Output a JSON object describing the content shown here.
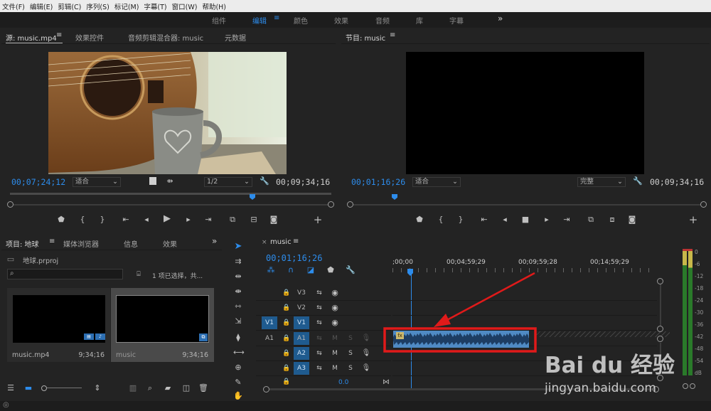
{
  "menu": [
    "文件(F)",
    "编辑(E)",
    "剪辑(C)",
    "序列(S)",
    "标记(M)",
    "字幕(T)",
    "窗口(W)",
    "帮助(H)"
  ],
  "workspaces": [
    "组件",
    "编辑",
    "颜色",
    "效果",
    "音频",
    "库",
    "字幕"
  ],
  "workspace_active": "编辑",
  "source": {
    "tabs": [
      "源: music.mp4",
      "效果控件",
      "音频剪辑混合器: music",
      "元数据"
    ],
    "timecode_left": "00;07;24;12",
    "fit": "适合",
    "resolution": "1/2",
    "timecode_right": "00;09;34;16"
  },
  "program": {
    "tab": "节目: music",
    "timecode_left": "00;01;16;26",
    "fit": "适合",
    "quality": "完整",
    "timecode_right": "00;09;34;16"
  },
  "project": {
    "tabs": [
      "项目: 地球",
      "媒体浏览器",
      "信息",
      "效果"
    ],
    "file": "地球.prproj",
    "status": "1 项已选择，共...",
    "items": [
      {
        "name": "music.mp4",
        "duration": "9;34;16"
      },
      {
        "name": "music",
        "duration": "9;34;16"
      }
    ]
  },
  "timeline": {
    "tab": "music",
    "timecode": "00;01;16;26",
    "ruler": [
      ";00;00",
      "00;04;59;29",
      "00;09;59;28",
      "00;14;59;29"
    ],
    "tracks": {
      "video": [
        "V3",
        "V2",
        "V1"
      ],
      "audio": [
        "A1",
        "A2",
        "A3"
      ],
      "src_v": "V1",
      "src_a": "A1",
      "mute": "M",
      "solo": "S",
      "master_value": "0.0"
    },
    "clip_fx": "fx"
  },
  "meter": {
    "scale": [
      "0",
      "-6",
      "-12",
      "-18",
      "-24",
      "-30",
      "-36",
      "-42",
      "-48",
      "-54",
      "dB"
    ]
  },
  "watermark": {
    "logo": "Bai du 经验",
    "url": "jingyan.baidu.com"
  }
}
